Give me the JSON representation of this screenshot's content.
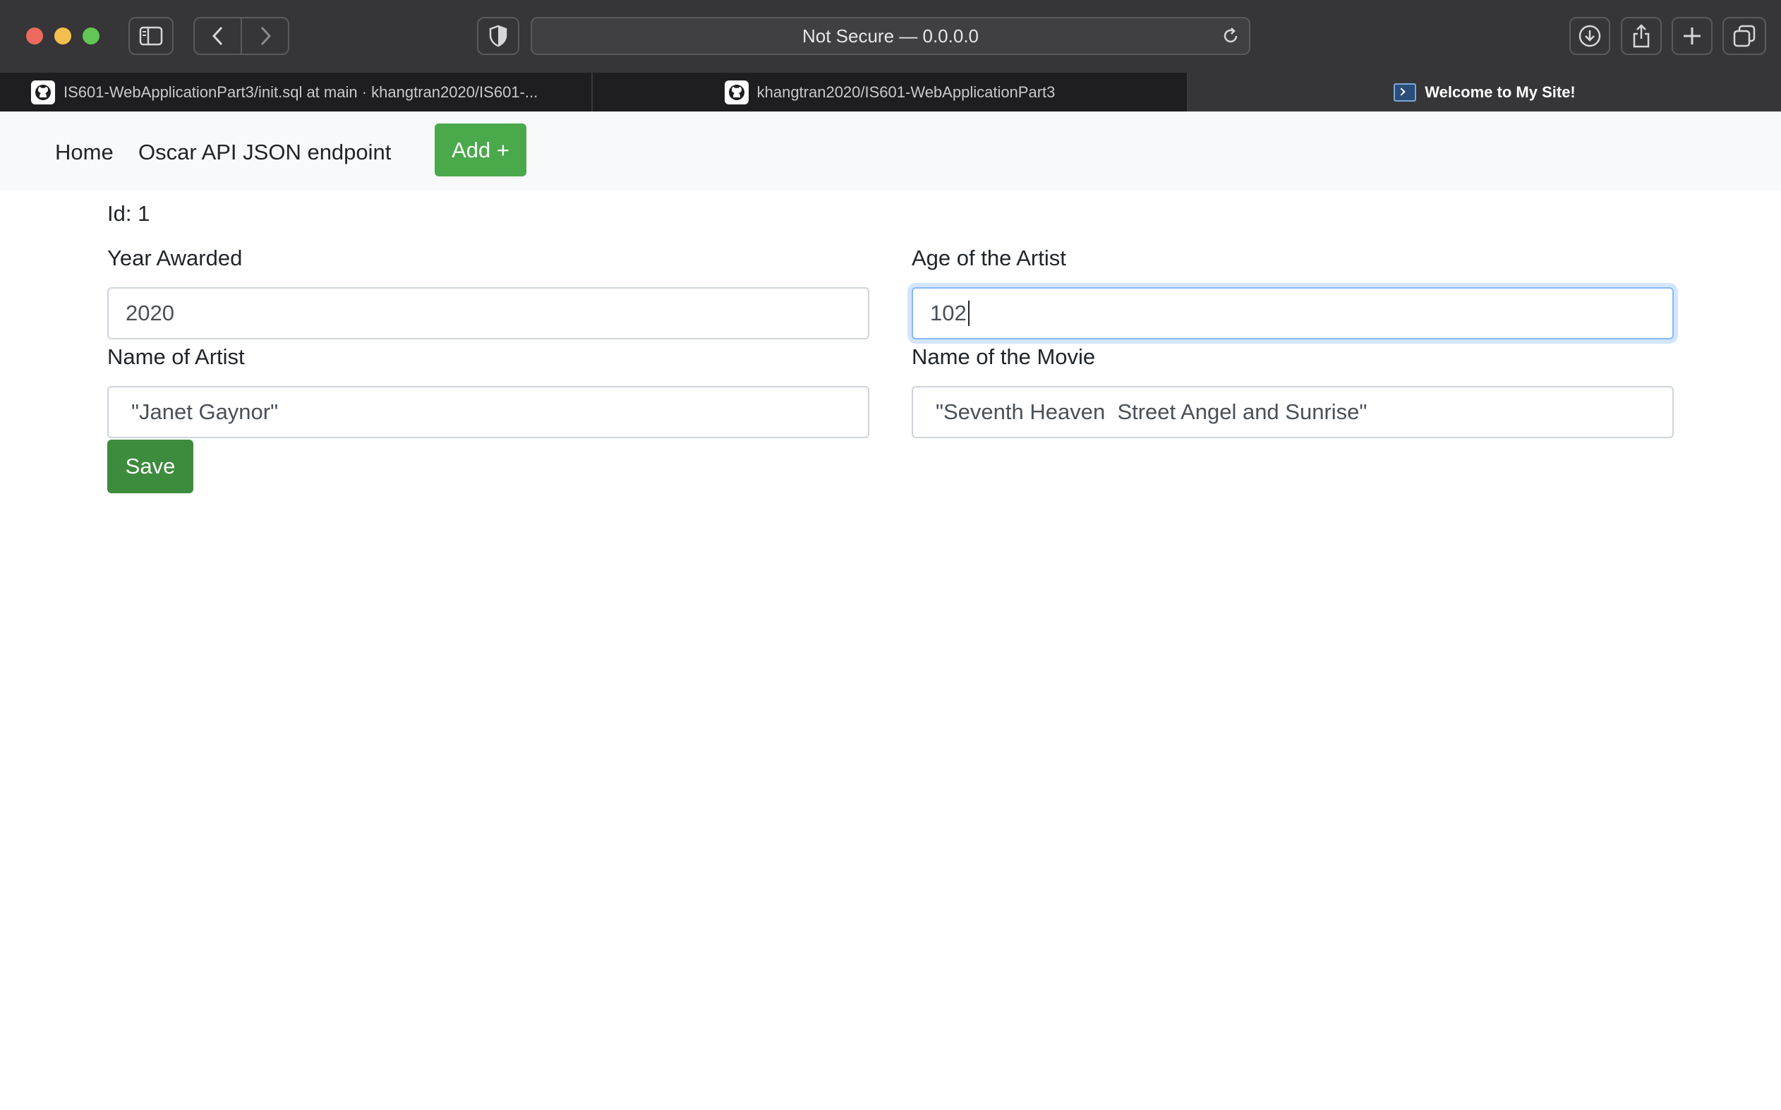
{
  "browser": {
    "address": "Not Secure — 0.0.0.0",
    "tabs": [
      {
        "label": "IS601-WebApplicationPart3/init.sql at main · khangtran2020/IS601-...",
        "icon": "github-icon"
      },
      {
        "label": "khangtran2020/IS601-WebApplicationPart3",
        "icon": "github-icon"
      },
      {
        "label": "Welcome to My Site!",
        "icon": "terminal-icon"
      }
    ]
  },
  "nav": {
    "home": "Home",
    "api": "Oscar API JSON endpoint",
    "add": "Add +"
  },
  "form": {
    "id_line": "Id: 1",
    "year_label": "Year Awarded",
    "year_value": "2020",
    "age_label": "Age of the Artist",
    "age_value": "102",
    "artist_label": "Name of Artist",
    "artist_value": "\"Janet Gaynor\"",
    "movie_label": "Name of the Movie",
    "movie_value": "\"Seventh Heaven  Street Angel and Sunrise\"",
    "save": "Save"
  },
  "colors": {
    "add_button": "#4aa94a",
    "save_button": "#3d8b3d",
    "focus_border": "#86b7fe"
  }
}
